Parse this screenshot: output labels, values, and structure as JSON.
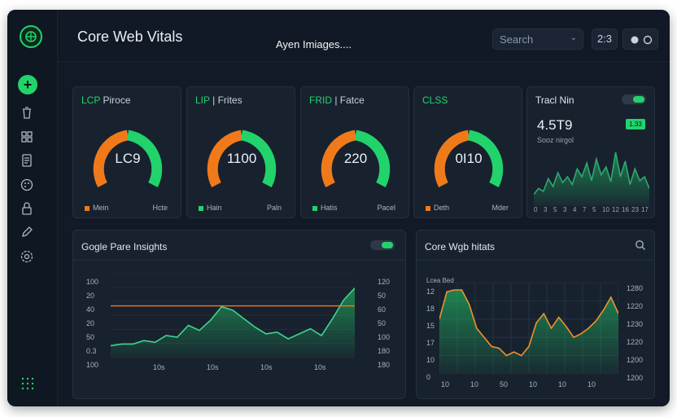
{
  "header": {
    "app_title": "Core Web Vitals",
    "center_title": "Ayen Imiages....",
    "search_placeholder": "Search",
    "count": "2:3"
  },
  "sidebar": {
    "items": [
      "add",
      "trash",
      "grid",
      "document",
      "palette",
      "lock",
      "edit",
      "settings",
      "apps"
    ]
  },
  "metrics": [
    {
      "title_green": "LCP",
      "title_rest": " Piroce",
      "value": "LC9",
      "legend_left": "Mein",
      "legend_right": "Hcte",
      "progress": 0.55
    },
    {
      "title_green": "LIP",
      "title_rest": " | Frites",
      "value": "1100",
      "legend_left": "Hain",
      "legend_right": "Paln",
      "progress": 0.55
    },
    {
      "title_green": "FRID",
      "title_rest": " | Fatce",
      "value": "220",
      "legend_left": "Hatis",
      "legend_right": "Pacel",
      "progress": 0.55
    },
    {
      "title_green": "CLSS",
      "title_rest": "",
      "value": "0I10",
      "legend_left": "Deth",
      "legend_right": "Mder",
      "progress": 0.55
    }
  ],
  "trend_card": {
    "title": "Tracl Nin",
    "value": "4.5T9",
    "sublabel": "Sooz nirgol",
    "badge": "1.33",
    "x_ticks": [
      "0",
      "3",
      "5",
      "3",
      "4",
      "7",
      "5",
      "10",
      "12",
      "16",
      "23",
      "17"
    ],
    "values": [
      12,
      18,
      15,
      28,
      20,
      34,
      24,
      30,
      22,
      38,
      30,
      44,
      26,
      48,
      32,
      40,
      25,
      55,
      30,
      46,
      22,
      38,
      26,
      30,
      18
    ]
  },
  "psi_card": {
    "title": "Gogle Pare Insights",
    "y_left": [
      "100",
      "20",
      "40",
      "20",
      "50",
      "0.3",
      "100"
    ],
    "y_right": [
      "120",
      "50",
      "60",
      "50",
      "100",
      "180",
      "180"
    ],
    "x_ticks": [
      "10s",
      "10s",
      "10s",
      "10s"
    ],
    "threshold": 61,
    "values": [
      14,
      16,
      16,
      20,
      18,
      26,
      24,
      38,
      32,
      44,
      60,
      56,
      46,
      36,
      28,
      30,
      22,
      28,
      34,
      26,
      46,
      68,
      82
    ]
  },
  "cwv_card": {
    "title": "Core Wgb hitats",
    "series_label": "Lcea Bed",
    "y_left": [
      "12",
      "18",
      "15",
      "17",
      "10",
      "0"
    ],
    "y_right": [
      "1280",
      "1220",
      "1230",
      "1220",
      "1200",
      "1200"
    ],
    "x_ticks": [
      "10",
      "10",
      "50",
      "10",
      "10",
      "10"
    ],
    "values": [
      60,
      90,
      92,
      92,
      76,
      50,
      40,
      30,
      28,
      20,
      24,
      20,
      30,
      56,
      66,
      50,
      62,
      52,
      40,
      44,
      50,
      58,
      70,
      84,
      66
    ]
  },
  "colors": {
    "accent": "#22d36b",
    "orange": "#f07a1a",
    "panel": "#18222f",
    "background": "#111a26"
  }
}
